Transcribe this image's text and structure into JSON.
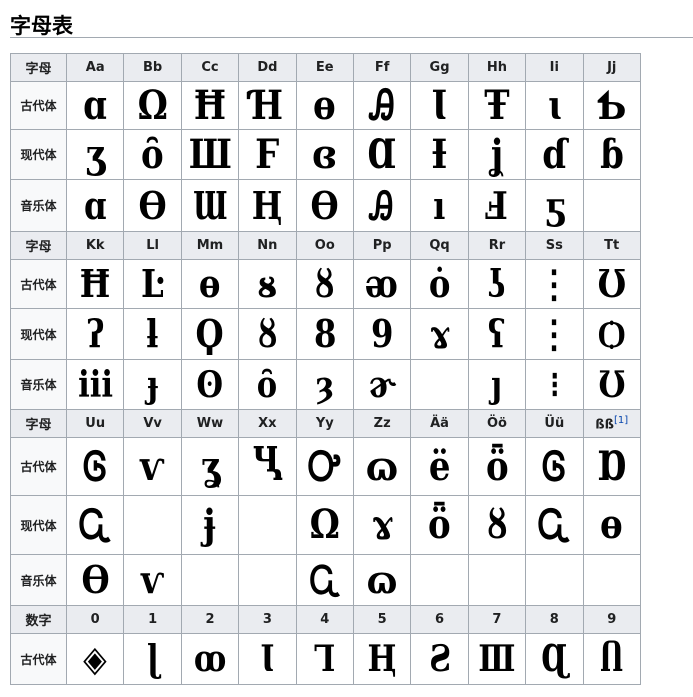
{
  "heading": "字母表",
  "sections": [
    {
      "header_label": "字母",
      "columns": [
        "Aa",
        "Bb",
        "Cc",
        "Dd",
        "Ee",
        "Ff",
        "Gg",
        "Hh",
        "Ii",
        "Jj"
      ],
      "rows": [
        {
          "label": "古代体",
          "glyphs": [
            "ɑ",
            "Ω",
            "Ħ",
            "Ɦ",
            "ɵ",
            "Ꭿ",
            "Ɩ",
            "Ŧ",
            "ɩ",
            "Ƅ"
          ]
        },
        {
          "label": "现代体",
          "glyphs": [
            "ʒ",
            "ȏ",
            "Ш",
            "Ϝ",
            "ɞ",
            "Ɑ",
            "Ɨ",
            "ʝ",
            "ɗ",
            "ɓ"
          ]
        },
        {
          "label": "音乐体",
          "glyphs": [
            "ɑ",
            "Ѳ",
            "Ɯ",
            "Ⱨ",
            "Ѳ",
            "Ꭿ",
            "ı",
            "Ⅎ",
            "ƽ",
            ""
          ]
        }
      ]
    },
    {
      "header_label": "字母",
      "columns": [
        "Kk",
        "Ll",
        "Mm",
        "Nn",
        "Oo",
        "Pp",
        "Qq",
        "Rr",
        "Ss",
        "Tt"
      ],
      "rows": [
        {
          "label": "古代体",
          "glyphs": [
            "Ħ",
            "Ŀ",
            "ɵ",
            "ᴕ",
            "ȣ",
            "ᴔ",
            "ȯ",
            "ʖ",
            "⋮",
            "Ʊ"
          ]
        },
        {
          "label": "现代体",
          "glyphs": [
            "ʔ",
            "ƚ",
            "Ϙ",
            "ȣ",
            "8",
            "9",
            "ɤ",
            "ʕ",
            "⋮",
            "Ѻ"
          ]
        },
        {
          "label": "音乐体",
          "glyphs": [
            "ⅲ",
            "ɟ",
            "ʘ",
            "ȏ",
            "ȝ",
            "ɚ",
            "",
            "ȷ",
            "⁝",
            "Ʊ"
          ]
        }
      ]
    },
    {
      "header_label": "字母",
      "columns": [
        "Uu",
        "Vv",
        "Ww",
        "Xx",
        "Yy",
        "Zz",
        "Ää",
        "Öö",
        "Üü",
        "ßß"
      ],
      "columns_sup": [
        null,
        null,
        null,
        null,
        null,
        null,
        null,
        null,
        null,
        "[1]"
      ],
      "rows": [
        {
          "label": "古代体",
          "glyphs": [
            "Ꮆ",
            "ⱱ",
            "ʓ",
            "Ⴁ",
            "Ꭴ",
            "ɷ",
            "ë",
            "ȫ",
            "Ꮆ",
            "Ɒ"
          ]
        },
        {
          "label": "现代体",
          "glyphs": [
            "Ꮹ",
            "",
            "ɉ",
            "",
            "Ω",
            "ɤ",
            "ȫ",
            "ȣ",
            "Ꮹ",
            "ɵ"
          ]
        },
        {
          "label": "音乐体",
          "glyphs": [
            "Ѳ",
            "ⱱ",
            "",
            "",
            "Ꮹ",
            "ɷ",
            "",
            "",
            "",
            ""
          ]
        }
      ]
    },
    {
      "header_label": "数字",
      "columns": [
        "0",
        "1",
        "2",
        "3",
        "4",
        "5",
        "6",
        "7",
        "8",
        "9"
      ],
      "rows": [
        {
          "label": "古代体",
          "glyphs": [
            "◈",
            "ɭ",
            "ꝏ",
            "Ɩ",
            "Ꞁ",
            "Ⱨ",
            "Ƨ",
            "Ⅲ",
            "Ɋ",
            "Ⴖ"
          ]
        }
      ]
    }
  ]
}
